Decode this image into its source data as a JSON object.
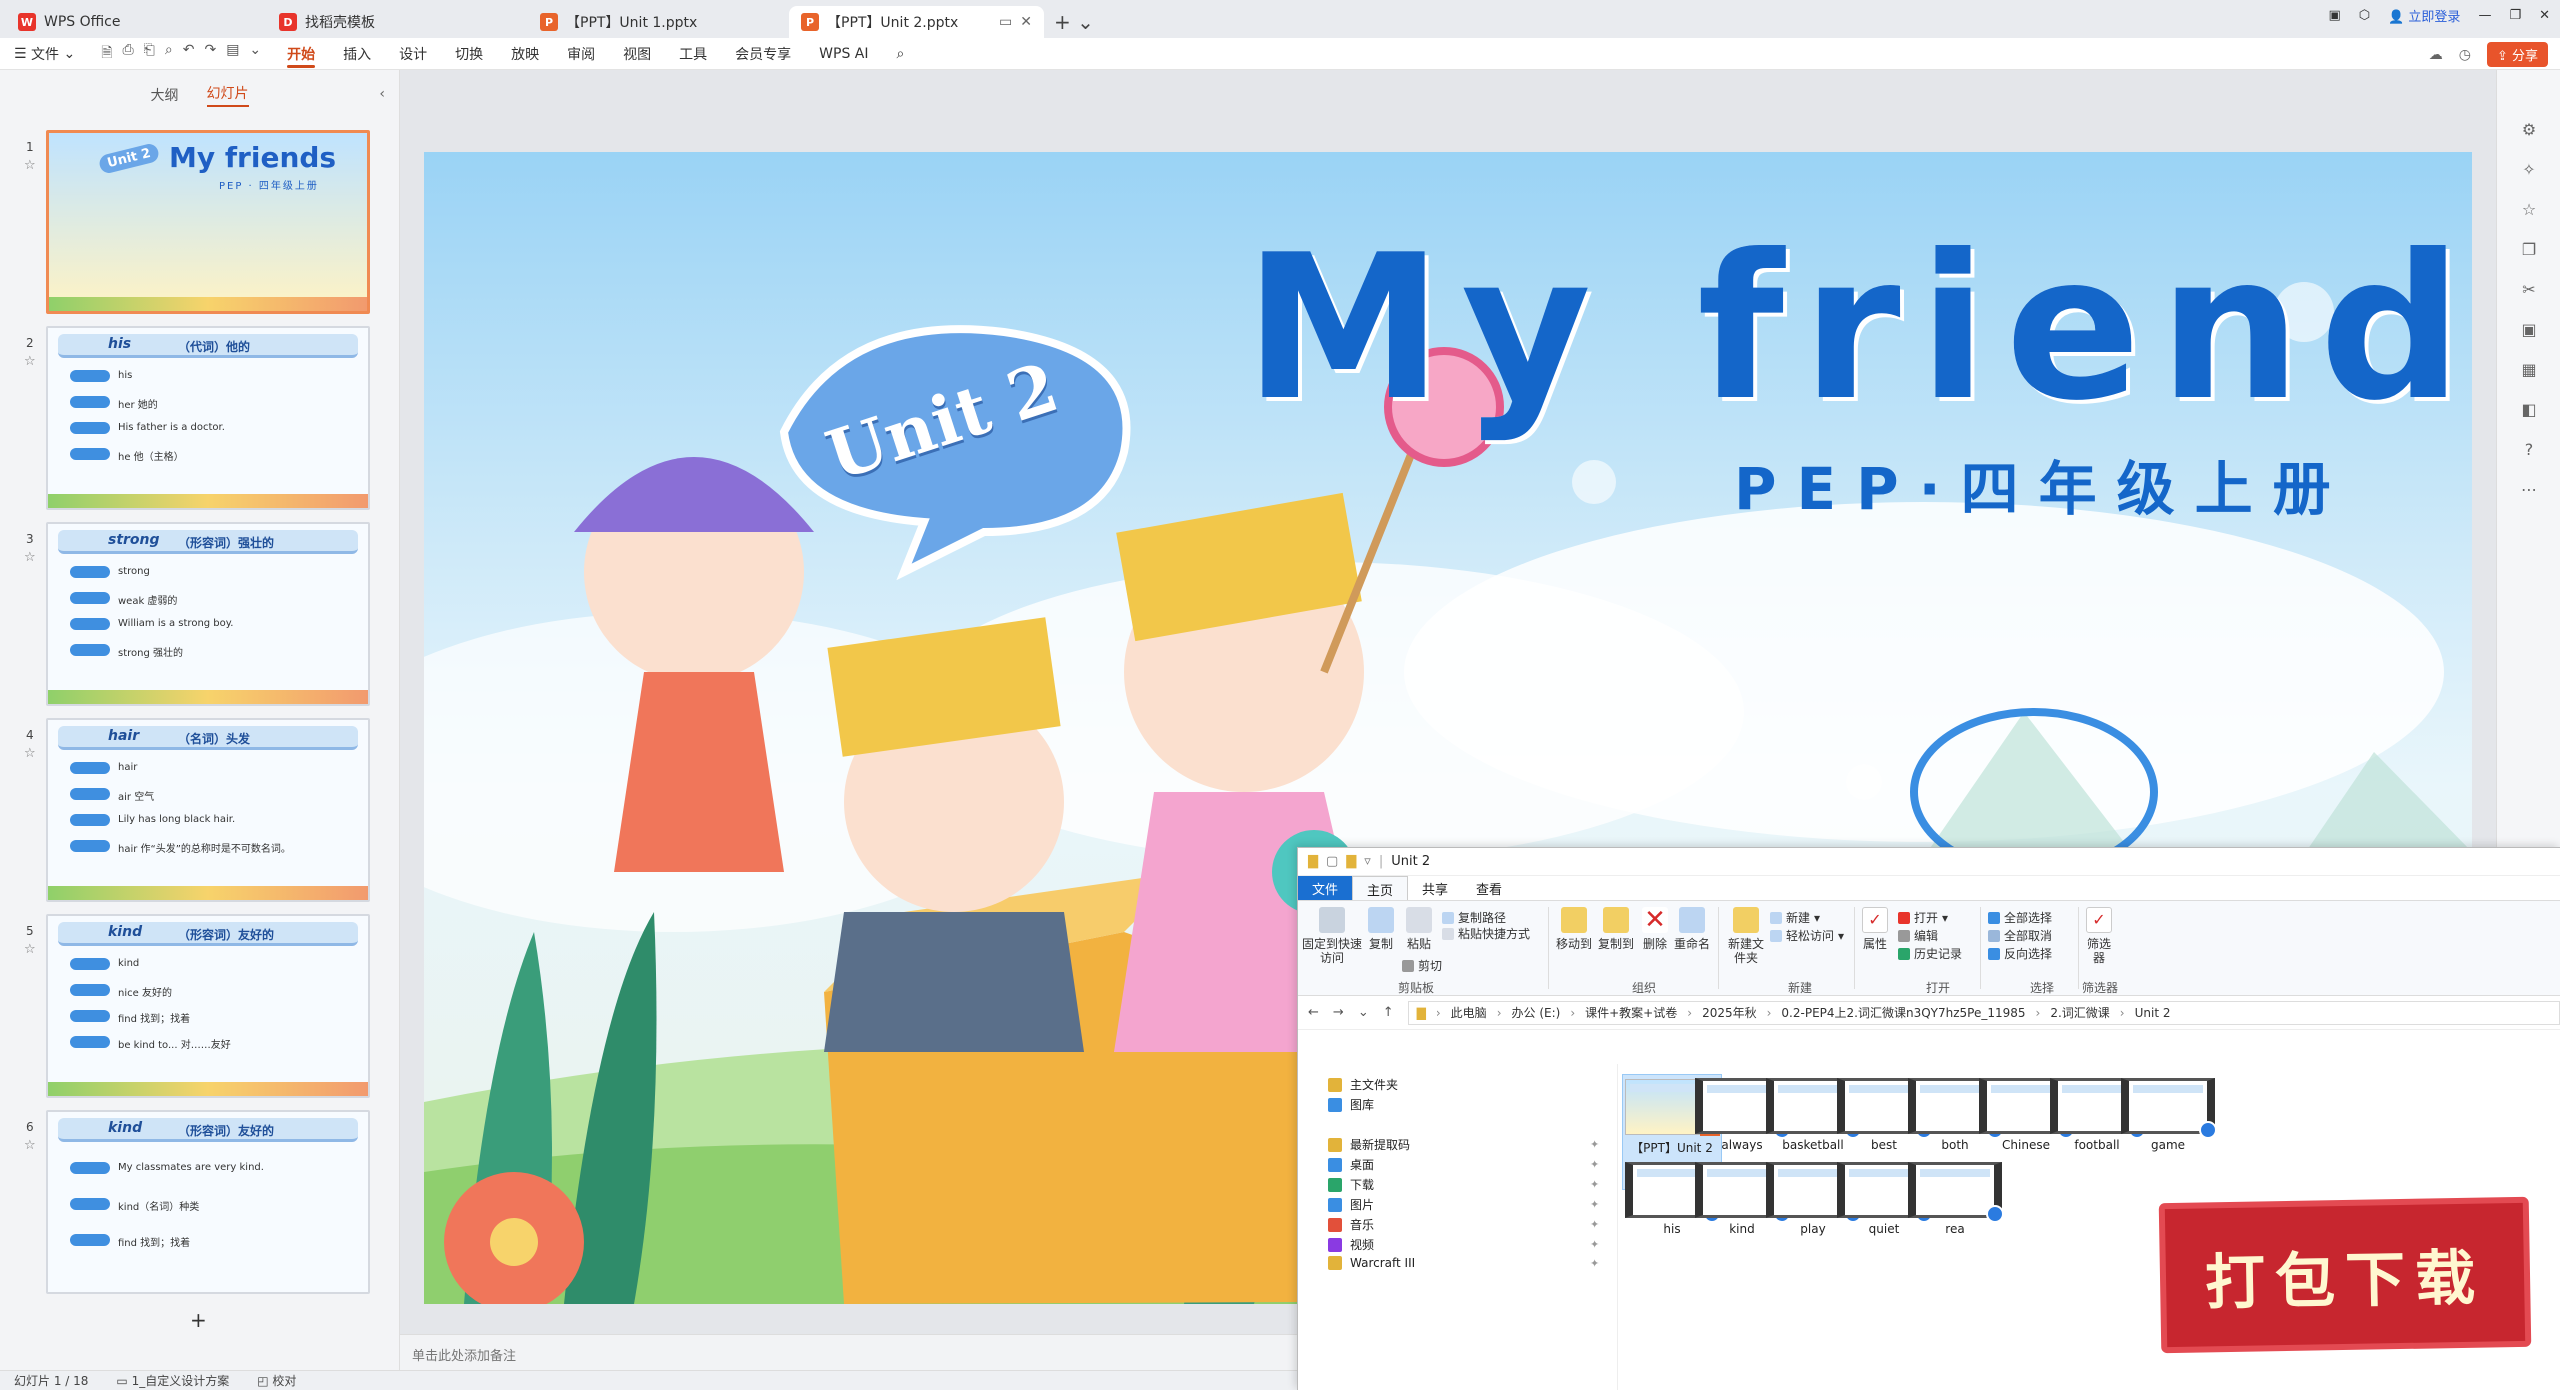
{
  "titlebar": {
    "tabs": [
      {
        "label": "WPS Office",
        "icon": "wps-logo-icon",
        "color": "#e8342b"
      },
      {
        "label": "找稻壳模板",
        "icon": "docer-icon",
        "color": "#e8342b"
      },
      {
        "label": "【PPT】Unit 1.pptx",
        "icon": "ppt-icon",
        "color": "#e8642b"
      },
      {
        "label": "【PPT】Unit 2.pptx",
        "icon": "ppt-icon",
        "color": "#e8642b"
      }
    ],
    "login": "立即登录"
  },
  "menubar": {
    "file": "文件",
    "items": [
      "开始",
      "插入",
      "设计",
      "切换",
      "放映",
      "审阅",
      "视图",
      "工具",
      "会员专享",
      "WPS AI"
    ],
    "active": "开始",
    "share": "分享"
  },
  "leftpanel": {
    "tab_outline": "大纲",
    "tab_slides": "幻灯片",
    "slides": [
      {
        "num": "1",
        "title": "My friends",
        "subtitle": "PEP · 四年级上册",
        "unit": "Unit 2"
      },
      {
        "num": "2",
        "title": "his",
        "subtitle": "（代词）他的",
        "lines": [
          "his",
          "her 她的",
          "His father is a doctor.",
          "he 他（主格）"
        ]
      },
      {
        "num": "3",
        "title": "strong",
        "subtitle": "（形容词）强壮的",
        "lines": [
          "strong",
          "weak 虚弱的",
          "William is a strong boy.",
          "strong 强壮的"
        ]
      },
      {
        "num": "4",
        "title": "hair",
        "subtitle": "（名词）头发",
        "lines": [
          "hair",
          "air 空气",
          "Lily has long black hair.",
          "hair 作“头发”的总称时是不可数名词。"
        ]
      },
      {
        "num": "5",
        "title": "kind",
        "subtitle": "（形容词）友好的",
        "lines": [
          "kind",
          "nice 友好的",
          "find 找到；找着",
          "be kind to... 对……友好"
        ]
      },
      {
        "num": "6",
        "title": "kind",
        "subtitle": "（形容词）友好的",
        "lines": [
          "My classmates are very kind.",
          "kind（名词）种类",
          "find 找到；找着"
        ]
      }
    ]
  },
  "slide": {
    "title": "My friends",
    "subtitle": "PEP·四年级上册",
    "unit": "Unit 2"
  },
  "notes_placeholder": "单击此处添加备注",
  "statusbar": {
    "slide_counter": "幻灯片 1 / 18",
    "theme": "1_自定义设计方案",
    "proof": "校对"
  },
  "explorer": {
    "title": "Unit 2",
    "tabs": [
      "文件",
      "主页",
      "共享",
      "查看"
    ],
    "ribbon": {
      "pin": "固定到快速访问",
      "copy": "复制",
      "paste": "粘贴",
      "copy_path": "复制路径",
      "paste_shortcut": "粘贴快捷方式",
      "cut": "剪切",
      "group_clipboard": "剪贴板",
      "move_to": "移动到",
      "copy_to": "复制到",
      "delete": "删除",
      "rename": "重命名",
      "group_organize": "组织",
      "new_folder": "新建文件夹",
      "new_item": "新建",
      "easy_access": "轻松访问",
      "group_new": "新建",
      "properties": "属性",
      "open": "打开",
      "edit": "编辑",
      "history": "历史记录",
      "group_open": "打开",
      "select_all": "全部选择",
      "select_none": "全部取消",
      "invert": "反向选择",
      "group_select": "选择",
      "filter": "筛选器",
      "group_filter": "筛选器"
    },
    "breadcrumb": [
      "此电脑",
      "办公 (E:)",
      "课件+教案+试卷",
      "2025年秋",
      "0.2-PEP4上2.词汇微课n3QY7hz5Pe_11985",
      "2.词汇微课",
      "Unit 2"
    ],
    "nav": [
      {
        "label": "主文件夹",
        "icon": "home-icon",
        "color": "#e2b33a"
      },
      {
        "label": "图库",
        "icon": "gallery-icon",
        "color": "#3a8ee2"
      },
      {
        "label": "最新提取码",
        "icon": "folder-icon",
        "color": "#e2b33a"
      },
      {
        "label": "桌面",
        "icon": "desktop-icon",
        "color": "#3a8ee2"
      },
      {
        "label": "下载",
        "icon": "download-icon",
        "color": "#2aa56a"
      },
      {
        "label": "图片",
        "icon": "pictures-icon",
        "color": "#3a8ee2"
      },
      {
        "label": "音乐",
        "icon": "music-icon",
        "color": "#e2503a"
      },
      {
        "label": "视频",
        "icon": "video-icon",
        "color": "#8a3ae2"
      },
      {
        "label": "Warcraft III",
        "icon": "folder-icon",
        "color": "#e2b33a"
      }
    ],
    "files": [
      "【PPT】Unit 2",
      "always",
      "basketball",
      "best",
      "both",
      "Chinese",
      "football",
      "game",
      "his",
      "kind",
      "play",
      "quiet",
      "rea"
    ]
  },
  "promo": "打包下载"
}
